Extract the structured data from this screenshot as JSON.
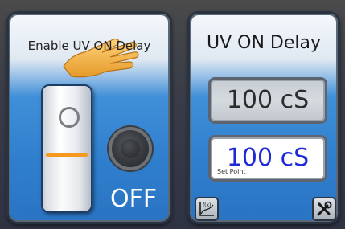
{
  "left_panel": {
    "title": "Enable UV ON Delay",
    "hand_icon": "pointing-hand-icon",
    "state_label": "OFF"
  },
  "right_panel": {
    "title": "UV ON Delay",
    "readout_value": "100 cS",
    "setpoint_value": "100 cS",
    "setpoint_label": "Set Point",
    "graph_icon": "function-graph-icon",
    "tools_icon": "tools-icon"
  },
  "colors": {
    "panel_blue": "#2f7fce",
    "switch_accent": "#f59a1f",
    "setpoint_text": "#1e2ad6"
  }
}
